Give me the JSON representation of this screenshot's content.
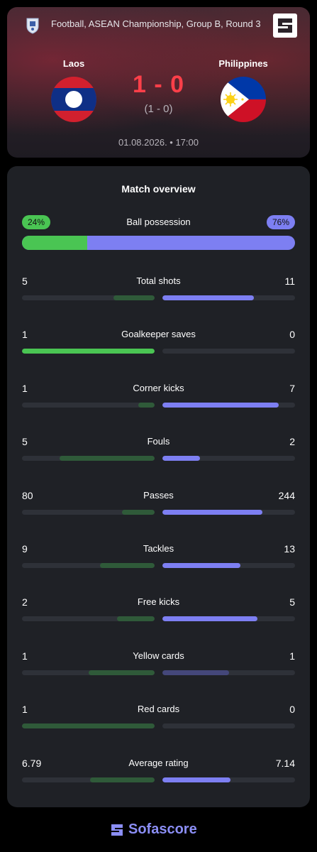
{
  "header": {
    "competition": "Football, ASEAN Championship, Group B, Round 3",
    "home_team": "Laos",
    "away_team": "Philippines",
    "score": "1 - 0",
    "halftime_score": "(1  -  0)",
    "datetime": "01.08.2026. • 17:00"
  },
  "overview": {
    "title": "Match overview",
    "possession": {
      "label": "Ball possession",
      "home": "24%",
      "away": "76%",
      "home_fraction": 0.24
    },
    "stats": [
      {
        "label": "Total shots",
        "home": "5",
        "away": "11",
        "home_fraction": 0.31,
        "away_fraction": 0.69,
        "winner": "away"
      },
      {
        "label": "Goalkeeper saves",
        "home": "1",
        "away": "0",
        "home_fraction": 1.0,
        "away_fraction": 0.0,
        "winner": "home"
      },
      {
        "label": "Corner kicks",
        "home": "1",
        "away": "7",
        "home_fraction": 0.125,
        "away_fraction": 0.875,
        "winner": "away"
      },
      {
        "label": "Fouls",
        "home": "5",
        "away": "2",
        "home_fraction": 0.714,
        "away_fraction": 0.286,
        "winner": "home_dim"
      },
      {
        "label": "Passes",
        "home": "80",
        "away": "244",
        "home_fraction": 0.247,
        "away_fraction": 0.753,
        "winner": "away"
      },
      {
        "label": "Tackles",
        "home": "9",
        "away": "13",
        "home_fraction": 0.41,
        "away_fraction": 0.59,
        "winner": "away"
      },
      {
        "label": "Free kicks",
        "home": "2",
        "away": "5",
        "home_fraction": 0.286,
        "away_fraction": 0.714,
        "winner": "away"
      },
      {
        "label": "Yellow cards",
        "home": "1",
        "away": "1",
        "home_fraction": 0.5,
        "away_fraction": 0.5,
        "winner": "draw"
      },
      {
        "label": "Red cards",
        "home": "1",
        "away": "0",
        "home_fraction": 1.0,
        "away_fraction": 0.0,
        "winner": "home_dim"
      },
      {
        "label": "Average rating",
        "home": "6.79",
        "away": "7.14",
        "home_fraction": 0.487,
        "away_fraction": 0.513,
        "winner": "away"
      }
    ]
  },
  "footer": {
    "brand": "Sofascore"
  },
  "colors": {
    "home_strong": "#4ac553",
    "home_dim": "#2f5a39",
    "away_strong": "#7d7ff2",
    "away_dim": "#44477a",
    "score": "#ff3f49"
  }
}
